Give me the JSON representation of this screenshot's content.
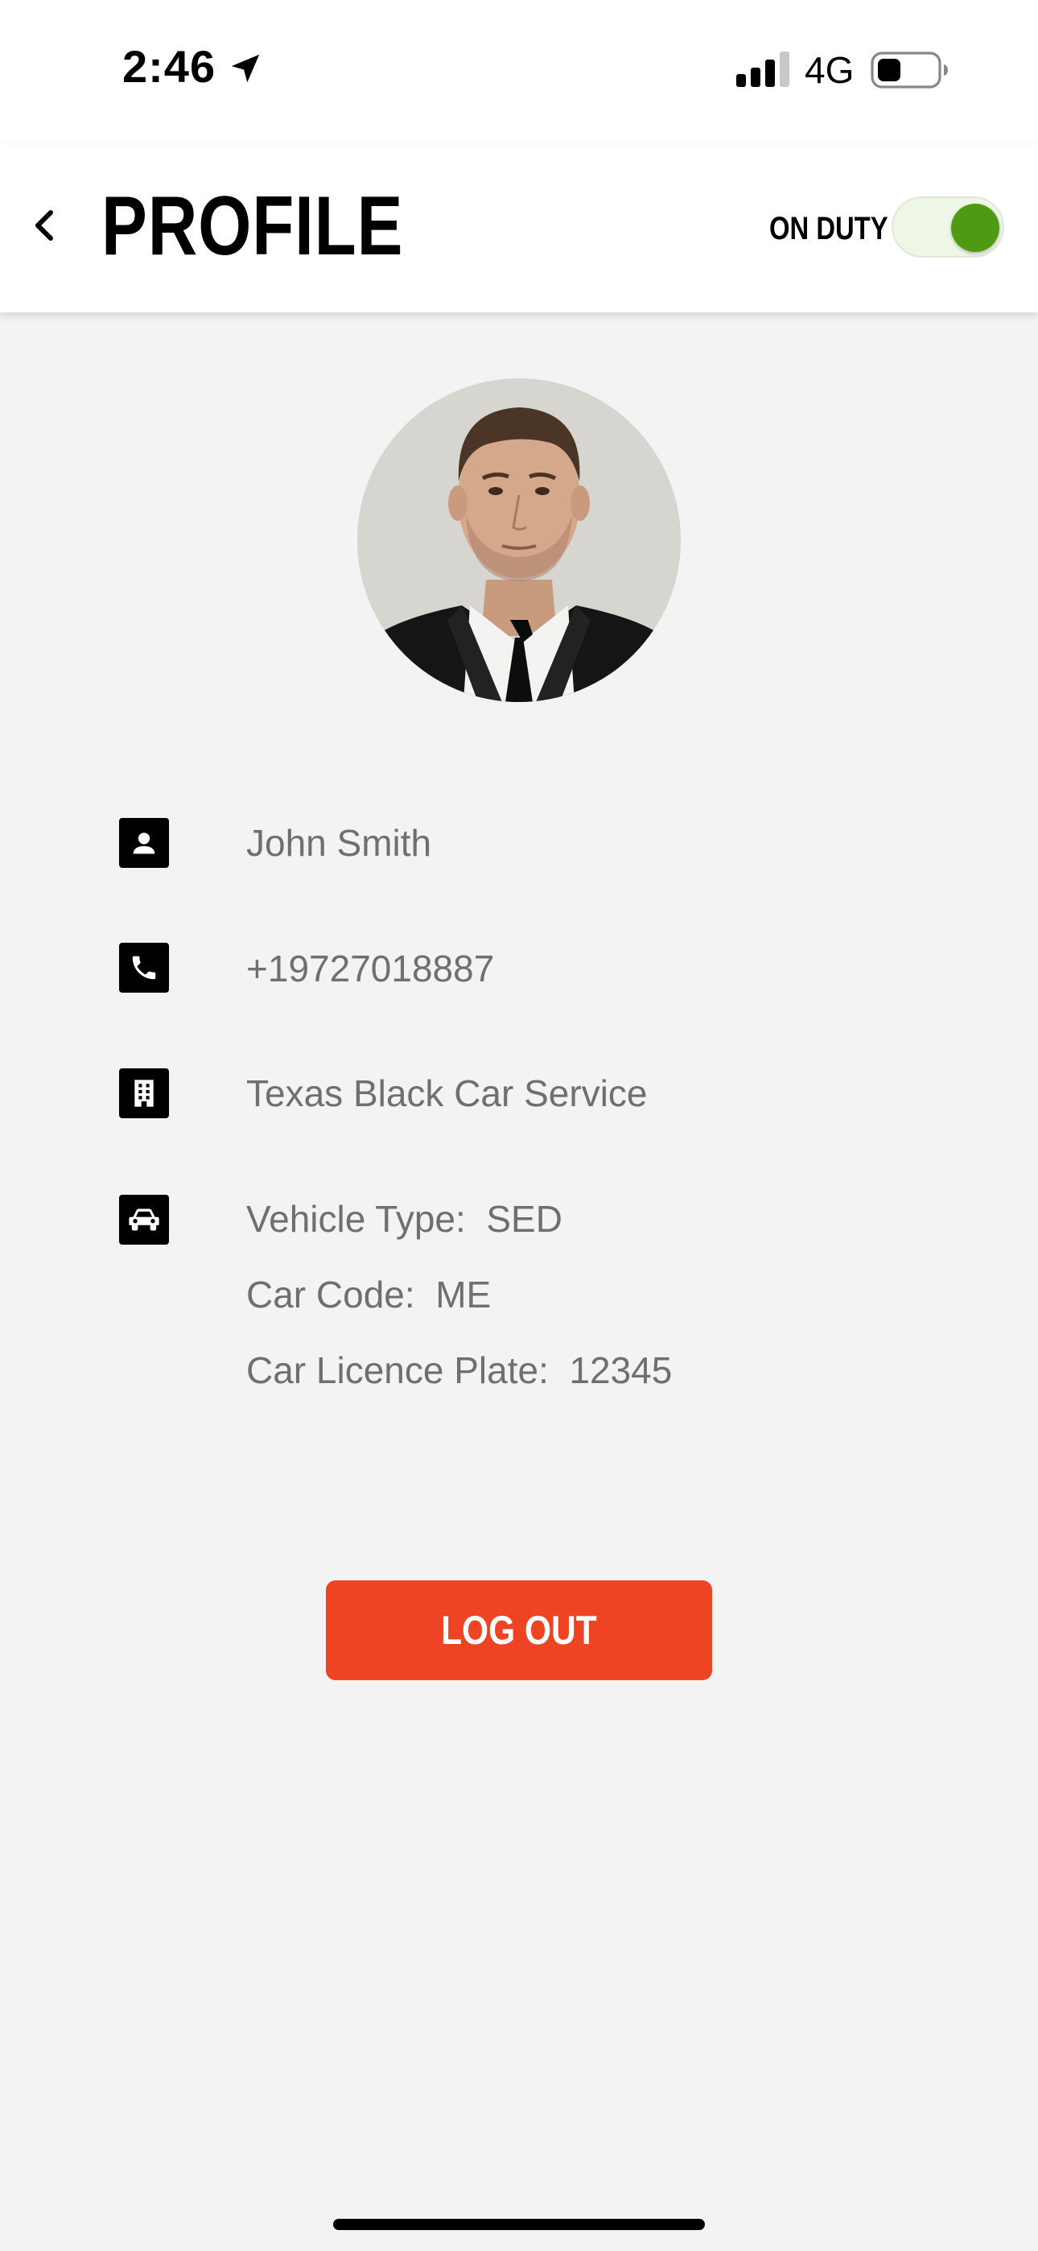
{
  "status_bar": {
    "time": "2:46",
    "network": "4G",
    "icons": [
      "location-arrow-icon",
      "signal-icon",
      "battery-icon"
    ]
  },
  "header": {
    "title": "PROFILE",
    "duty_label": "ON DUTY",
    "duty_on": true,
    "back_icon": "chevron-left-icon"
  },
  "profile": {
    "name": "John Smith",
    "phone": "+19727018887",
    "company": "Texas Black Car Service",
    "vehicle": {
      "type_label": "Vehicle Type:",
      "type_value": "SED",
      "code_label": "Car Code:",
      "code_value": "ME",
      "plate_label": "Car Licence Plate:",
      "plate_value": "12345"
    }
  },
  "logout_label": "LOG OUT",
  "colors": {
    "accent": "#ee4424",
    "toggle_on": "#4f9a14",
    "text_muted": "#6f6f6f",
    "background": "#f3f3f3"
  }
}
